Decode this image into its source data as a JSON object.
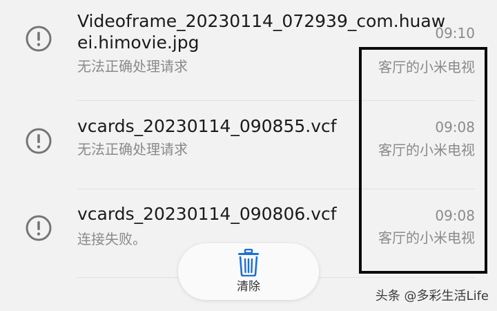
{
  "notifications": [
    {
      "filename_line1": "Videoframe_20230114_072939_com.huaw",
      "filename_line2": "ei.himovie.jpg",
      "status": "无法正确处理请求",
      "time": "09:10",
      "device": "客厅的小米电视",
      "icon": "alert-circle-icon"
    },
    {
      "filename_line1": "vcards_20230114_090855.vcf",
      "status": "无法正确处理请求",
      "time": "09:08",
      "device": "客厅的小米电视",
      "icon": "alert-circle-icon"
    },
    {
      "filename_line1": "vcards_20230114_090806.vcf",
      "status": "连接失败。",
      "time": "09:08",
      "device": "客厅的小米电视",
      "icon": "alert-circle-icon"
    }
  ],
  "toolbar": {
    "clear_label": "清除",
    "clear_icon": "trash-icon"
  },
  "watermark": "头条 @多彩生活Life",
  "colors": {
    "background": "#f2f2f2",
    "primary_text": "#1a1a1a",
    "secondary_text": "#8a8a8a",
    "trash_blue": "#1d6fd6",
    "highlight_border": "#0a0a0a"
  }
}
